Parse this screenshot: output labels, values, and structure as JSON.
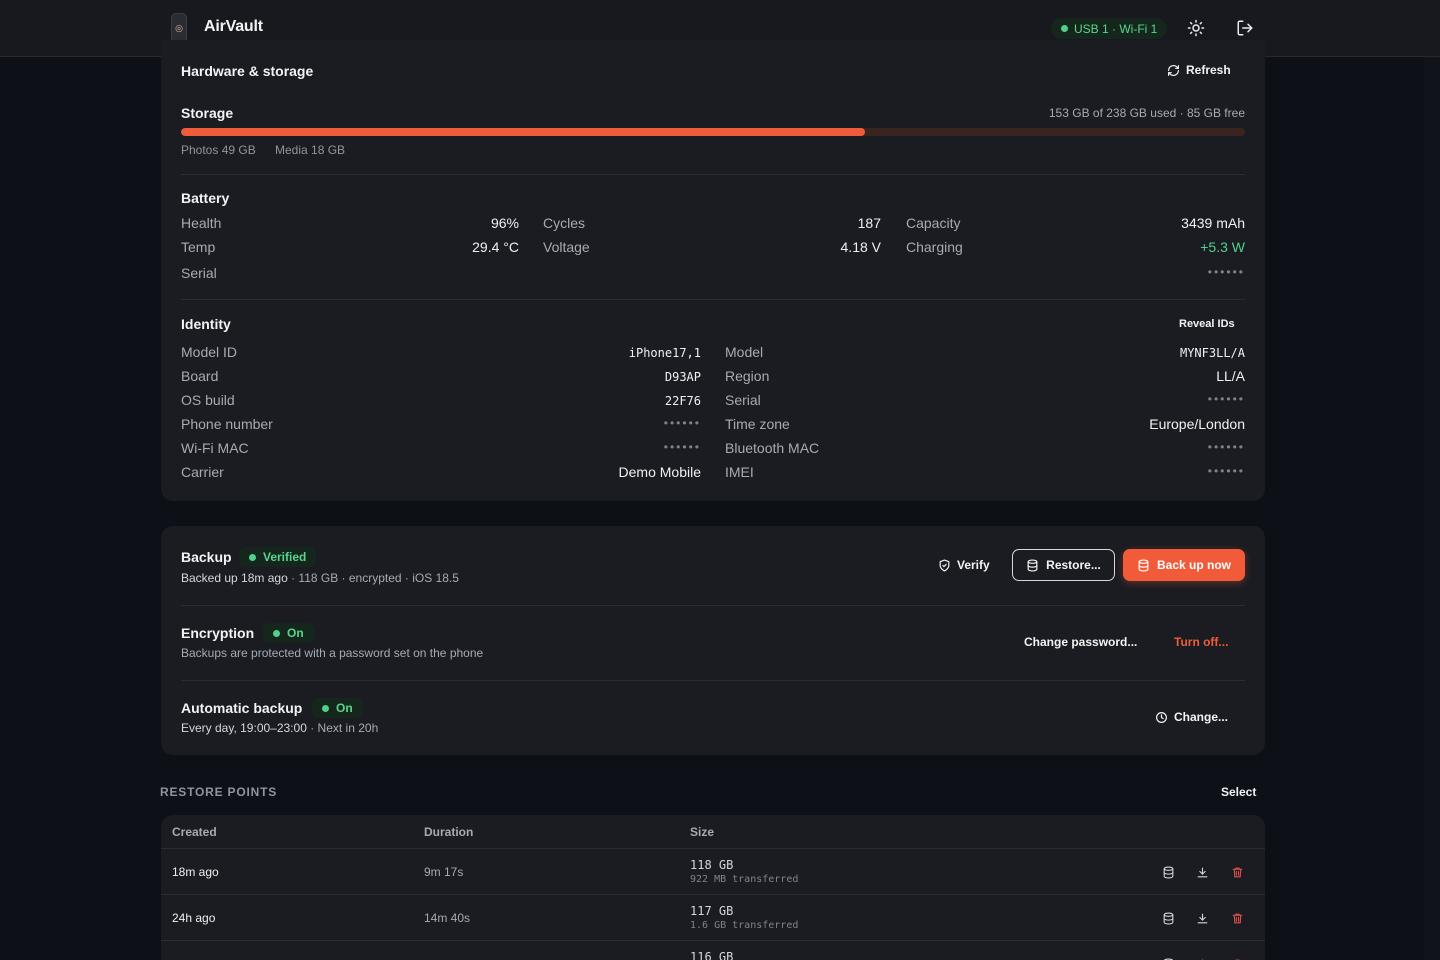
{
  "header": {
    "app_name": "AirVault",
    "connection": "USB 1 · Wi-Fi 1"
  },
  "hardware": {
    "title": "Hardware & storage",
    "refresh_label": "Refresh",
    "storage": {
      "title": "Storage",
      "summary": "153 GB of 238 GB used · 85 GB free",
      "used_fraction": 0.643,
      "breakdown": [
        "Photos 49 GB",
        "Media 18 GB"
      ]
    },
    "battery": {
      "title": "Battery",
      "health_label": "Health",
      "health": "96%",
      "cycles_label": "Cycles",
      "cycles": "187",
      "capacity_label": "Capacity",
      "capacity": "3439 mAh",
      "temp_label": "Temp",
      "temp": "29.4 °C",
      "voltage_label": "Voltage",
      "voltage": "4.18 V",
      "charging_label": "Charging",
      "charging": "+5.3 W",
      "serial_label": "Serial",
      "serial": "••••••"
    },
    "identity": {
      "title": "Identity",
      "reveal_label": "Reveal IDs",
      "left": [
        {
          "label": "Model ID",
          "value": "iPhone17,1"
        },
        {
          "label": "Board",
          "value": "D93AP"
        },
        {
          "label": "OS build",
          "value": "22F76"
        },
        {
          "label": "Phone number",
          "value": "••••••"
        },
        {
          "label": "Wi-Fi MAC",
          "value": "••••••"
        },
        {
          "label": "Carrier",
          "value": "Demo Mobile"
        }
      ],
      "right": [
        {
          "label": "Model",
          "value": "MYNF3LL/A"
        },
        {
          "label": "Region",
          "value": "LL/A"
        },
        {
          "label": "Serial",
          "value": "••••••"
        },
        {
          "label": "Time zone",
          "value": "Europe/London"
        },
        {
          "label": "Bluetooth MAC",
          "value": "••••••"
        },
        {
          "label": "IMEI",
          "value": "••••••"
        }
      ]
    }
  },
  "backup": {
    "title": "Backup",
    "status": "Verified",
    "details": "Backed up 18m ago",
    "details_extra": " · 118 GB  · encrypted  · iOS 18.5",
    "verify_label": "Verify",
    "restore_label": "Restore...",
    "backup_now_label": "Back up now"
  },
  "encryption": {
    "title": "Encryption",
    "status": "On",
    "description": "Backups are protected with a password set on the phone",
    "change_password_label": "Change password...",
    "turn_off_label": "Turn off..."
  },
  "auto_backup": {
    "title": "Automatic backup",
    "status": "On",
    "schedule": "Every day, 19:00–23:00",
    "next": " · Next in 20h",
    "change_label": "Change..."
  },
  "restore_points": {
    "heading": "RESTORE POINTS",
    "select_label": "Select",
    "columns": [
      "Created",
      "Duration",
      "Size"
    ],
    "rows": [
      {
        "created": "18m ago",
        "duration": "9m 17s",
        "size": "118 GB",
        "transferred": "922 MB transferred"
      },
      {
        "created": "24h ago",
        "duration": "14m 40s",
        "size": "117 GB",
        "transferred": "1.6 GB transferred"
      },
      {
        "created": "",
        "duration": "",
        "size": "116 GB",
        "transferred": ""
      }
    ]
  },
  "colors": {
    "accent": "#f25b3a",
    "success": "#4fd18b",
    "danger": "#e0524f",
    "background": "#0d1016",
    "card": "#1a1c21"
  }
}
